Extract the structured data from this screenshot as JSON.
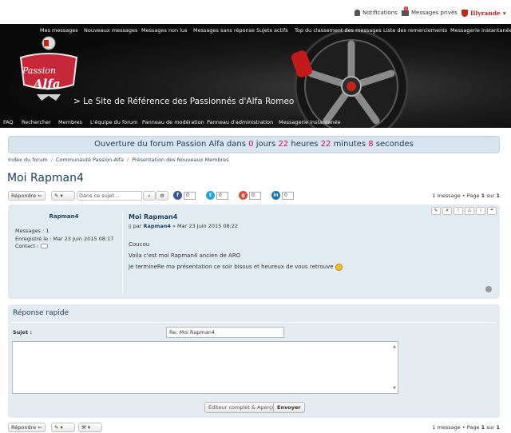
{
  "topbar": {
    "notifications": "Notifications",
    "private_messages": "Messages privés",
    "pm_count": "1",
    "username": "Illyrande"
  },
  "header": {
    "top_nav": [
      "Mes messages",
      "Nouveaux messages",
      "Messages non lus",
      "Messages sans réponse",
      "Sujets actifs",
      "Top du classement des messages",
      "Liste des remerciements",
      "Messagerie instantanée"
    ],
    "logo_text_1": "Passion",
    "logo_text_2": "Alfa",
    "tagline": "> Le Site de Référence des Passionnés d'Alfa Romeo",
    "bottom_nav": [
      "FAQ",
      "Rechercher",
      "Membres",
      "L'équipe du forum",
      "Panneau de modération",
      "Panneau d'administration",
      "Messagerie instantanée"
    ]
  },
  "countdown": {
    "prefix": "Ouverture du forum Passion Alfa dans",
    "days": "0",
    "days_label": "jours",
    "hours": "22",
    "hours_label": "heures",
    "minutes": "22",
    "minutes_label": "minutes",
    "seconds": "8",
    "seconds_label": "secondes"
  },
  "breadcrumb": [
    "Index du forum",
    "Communauté Passion-Alfa",
    "Présentation des Nouveaux Membres"
  ],
  "topic_title": "Moi Rapman4",
  "actions": {
    "reply_label": "Répondre",
    "search_placeholder": "Dans ce sujet...",
    "share_counts": [
      "0",
      "0",
      "0",
      "0"
    ],
    "pager_prefix": "1 message • Page",
    "pager_page": "1",
    "pager_sep": "sur",
    "pager_total": "1"
  },
  "post": {
    "author": "Rapman4",
    "profile": {
      "messages": "Messages : 1",
      "registered": "Enregistré le : Mar 23 Juin 2015 08:17",
      "contact": "Contact :"
    },
    "title": "Moi Rapman4",
    "meta_by": "par",
    "meta_author": "Rapman4",
    "meta_date": "» Mar 23 Juin 2015 08:22",
    "body": [
      "Coucou",
      "Voila c'est moi Rapman4 ancien de ARO",
      "Je termineRe ma présentation ce soir bisous et heureux de vous retrouve"
    ]
  },
  "quick_reply": {
    "title": "Réponse rapide",
    "subject_label": "Sujet :",
    "subject_value": "Re: Moi Rapman4",
    "full_editor_label": "Éditeur complet & Aperçu",
    "send_label": "Envoyer"
  },
  "colors": {
    "accent_red": "#d31141",
    "link_blue": "#1c3d5e",
    "post_bg": "#e1ebf2"
  }
}
